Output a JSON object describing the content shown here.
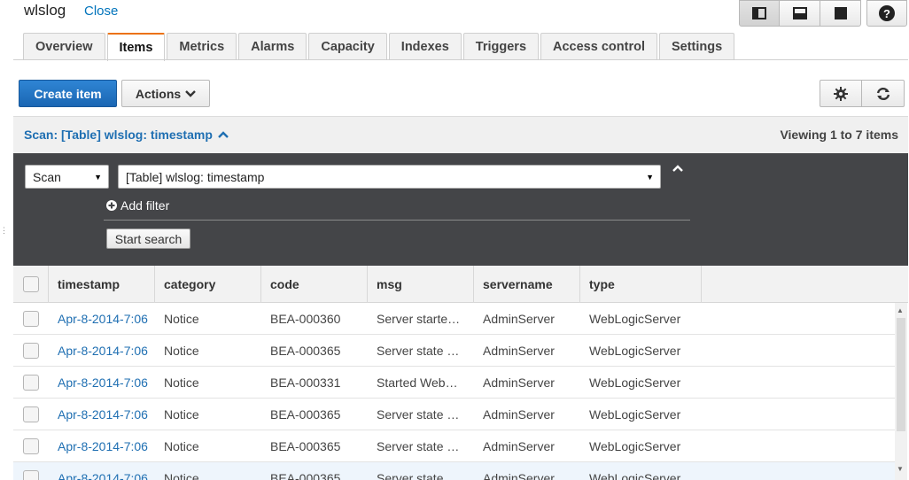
{
  "header": {
    "title": "wlslog",
    "close_label": "Close"
  },
  "tabs": [
    {
      "label": "Overview",
      "active": false
    },
    {
      "label": "Items",
      "active": true
    },
    {
      "label": "Metrics",
      "active": false
    },
    {
      "label": "Alarms",
      "active": false
    },
    {
      "label": "Capacity",
      "active": false
    },
    {
      "label": "Indexes",
      "active": false
    },
    {
      "label": "Triggers",
      "active": false
    },
    {
      "label": "Access control",
      "active": false
    },
    {
      "label": "Settings",
      "active": false
    }
  ],
  "toolbar": {
    "create_label": "Create item",
    "actions_label": "Actions"
  },
  "scan": {
    "title": "Scan: [Table] wlslog: timestamp",
    "viewing": "Viewing 1 to 7 items",
    "mode_value": "Scan",
    "target_value": "[Table] wlslog: timestamp",
    "add_filter_label": "Add filter",
    "start_label": "Start search"
  },
  "table": {
    "columns": [
      "timestamp",
      "category",
      "code",
      "msg",
      "servername",
      "type"
    ],
    "rows": [
      [
        "Apr-8-2014-7:06",
        "Notice",
        "BEA-000360",
        "Server started in RUNNING mode",
        "AdminServer",
        "WebLogicServer"
      ],
      [
        "Apr-8-2014-7:06",
        "Notice",
        "BEA-000365",
        "Server state changed to RUNNING",
        "AdminServer",
        "WebLogicServer"
      ],
      [
        "Apr-8-2014-7:06",
        "Notice",
        "BEA-000331",
        "Started WebLogic AdminServer",
        "AdminServer",
        "WebLogicServer"
      ],
      [
        "Apr-8-2014-7:06",
        "Notice",
        "BEA-000365",
        "Server state changed to STANDBY",
        "AdminServer",
        "WebLogicServer"
      ],
      [
        "Apr-8-2014-7:06",
        "Notice",
        "BEA-000365",
        "Server state changed to STARTING",
        "AdminServer",
        "WebLogicServer"
      ],
      [
        "Apr-8-2014-7:06",
        "Notice",
        "BEA-000365",
        "Server state changed to ADMIN",
        "AdminServer",
        "WebLogicServer"
      ]
    ]
  },
  "colors": {
    "accent": "#ec7211",
    "link": "#1f6fb2",
    "primary": "#1f6fb9",
    "panel": "#444548"
  }
}
